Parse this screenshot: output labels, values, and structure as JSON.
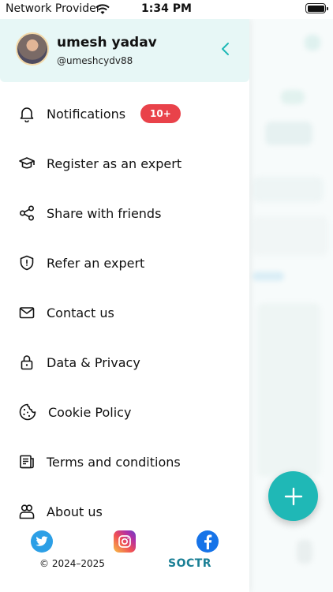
{
  "status_bar": {
    "carrier": "Network Provider",
    "time": "1:34 PM"
  },
  "profile": {
    "name": "umesh yadav",
    "handle": "@umeshcydv88"
  },
  "menu": {
    "items": [
      {
        "label": "Notifications",
        "icon": "bell-icon"
      },
      {
        "label": "Register as an expert",
        "icon": "graduation-cap-icon"
      },
      {
        "label": "Share with friends",
        "icon": "share-icon"
      },
      {
        "label": "Refer an expert",
        "icon": "shield-icon"
      },
      {
        "label": "Contact us",
        "icon": "envelope-icon"
      },
      {
        "label": "Data & Privacy",
        "icon": "lock-icon"
      },
      {
        "label": "Cookie Policy",
        "icon": "cookie-icon"
      },
      {
        "label": "Terms and conditions",
        "icon": "document-icon"
      },
      {
        "label": "About us",
        "icon": "people-icon"
      }
    ],
    "notifications_badge": "10+"
  },
  "footer": {
    "social": [
      "twitter-icon",
      "instagram-icon",
      "facebook-icon"
    ],
    "copyright": "© 2024–2025",
    "brand": "SOCTR"
  },
  "colors": {
    "accent": "#1fb8b6",
    "profile_bg": "#e7f7f6",
    "badge": "#e9424a",
    "brand": "#1a7f95"
  }
}
